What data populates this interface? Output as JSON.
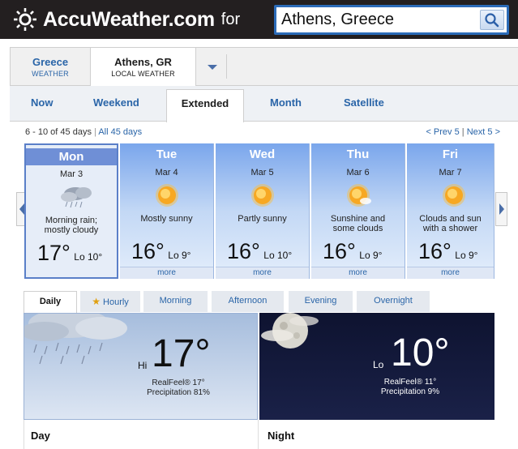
{
  "header": {
    "logo_text": "AccuWeather.com",
    "for_text": "for",
    "search_value": "Athens, Greece",
    "search_icon": "search-icon"
  },
  "location_tabs": [
    {
      "title": "Greece",
      "subtitle": "WEATHER"
    },
    {
      "title": "Athens, GR",
      "subtitle": "LOCAL WEATHER"
    }
  ],
  "nav_tabs": [
    "Now",
    "Weekend",
    "Extended",
    "Month",
    "Satellite"
  ],
  "active_nav": "Extended",
  "range": {
    "text": "6 - 10 of 45 days",
    "separator": "|",
    "all_link": "All 45 days"
  },
  "pager": {
    "prev": "< Prev 5",
    "separator": "|",
    "next": "Next 5 >"
  },
  "days": [
    {
      "name": "Mon",
      "date": "Mar 3",
      "cond1": "Morning rain;",
      "cond2": "mostly cloudy",
      "hi": "17°",
      "lo": "Lo 10°",
      "icon": "rain-cloud-icon"
    },
    {
      "name": "Tue",
      "date": "Mar 4",
      "cond1": "Mostly sunny",
      "cond2": "",
      "hi": "16°",
      "lo": "Lo 9°",
      "more": "more",
      "icon": "sun-icon"
    },
    {
      "name": "Wed",
      "date": "Mar 5",
      "cond1": "Partly sunny",
      "cond2": "",
      "hi": "16°",
      "lo": "Lo 10°",
      "more": "more",
      "icon": "sun-icon"
    },
    {
      "name": "Thu",
      "date": "Mar 6",
      "cond1": "Sunshine and",
      "cond2": "some clouds",
      "hi": "16°",
      "lo": "Lo 9°",
      "more": "more",
      "icon": "sun-cloud-icon"
    },
    {
      "name": "Fri",
      "date": "Mar 7",
      "cond1": "Clouds and sun",
      "cond2": "with a shower",
      "hi": "16°",
      "lo": "Lo 9°",
      "more": "more",
      "icon": "sun-icon"
    }
  ],
  "period_tabs": [
    "Daily",
    "Hourly",
    "Morning",
    "Afternoon",
    "Evening",
    "Overnight"
  ],
  "day_panel": {
    "label": "Hi",
    "temp": "17°",
    "realfeel": "RealFeel® 17°",
    "precip": "Precipitation 81%",
    "title": "Day"
  },
  "night_panel": {
    "label": "Lo",
    "temp": "10°",
    "realfeel": "RealFeel® 11°",
    "precip": "Precipitation 9%",
    "title": "Night"
  },
  "colors": {
    "header_bg": "#231f20",
    "link": "#2a65a8",
    "search_border": "#2b6bb8"
  }
}
